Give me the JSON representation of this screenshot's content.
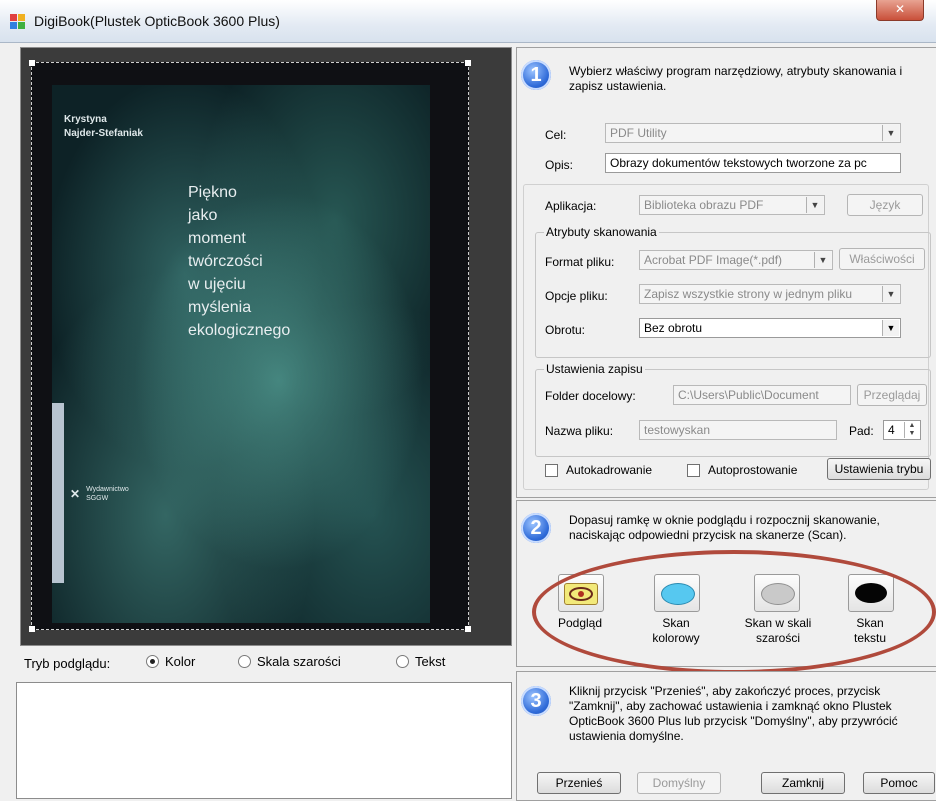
{
  "window": {
    "title": "DigiBook(Plustek OpticBook 3600 Plus)",
    "close_label": "✕"
  },
  "preview": {
    "book": {
      "author": "Krystyna\nNajder-Stefaniak",
      "title": "Piękno\njako\nmoment\ntwórczości\nw ujęciu\nmyślenia\nekologicznego",
      "publisher": "Wydawnictwo\nSGGW"
    },
    "mode_label": "Tryb podglądu:",
    "modes": [
      {
        "label": "Kolor",
        "selected": true
      },
      {
        "label": "Skala szarości",
        "selected": false
      },
      {
        "label": "Tekst",
        "selected": false
      }
    ]
  },
  "step1": {
    "number": "1",
    "text": "Wybierz właściwy program narzędziowy, atrybuty skanowania i zapisz ustawienia.",
    "target_label": "Cel:",
    "target_value": "PDF Utility",
    "desc_label": "Opis:",
    "desc_value": "Obrazy dokumentów tekstowych tworzone za pc",
    "app_label": "Aplikacja:",
    "app_value": "Biblioteka obrazu PDF",
    "lang_button": "Język",
    "attrs_group": "Atrybuty skanowania",
    "format_label": "Format pliku:",
    "format_value": "Acrobat PDF Image(*.pdf)",
    "props_button": "Właściwości",
    "options_label": "Opcje pliku:",
    "options_value": "Zapisz wszystkie strony w jednym pliku",
    "rotate_label": "Obrotu:",
    "rotate_value": "Bez obrotu",
    "save_group": "Ustawienia zapisu",
    "folder_label": "Folder docelowy:",
    "folder_value": "C:\\Users\\Public\\Document",
    "browse_button": "Przeglądaj",
    "filename_label": "Nazwa pliku:",
    "filename_value": "testowyskan",
    "pad_label": "Pad:",
    "pad_value": "4",
    "autocrop_label": "Autokadrowanie",
    "autostraighten_label": "Autoprostowanie",
    "mode_settings_button": "Ustawienia trybu"
  },
  "step2": {
    "number": "2",
    "text": "Dopasuj ramkę w oknie podglądu i rozpocznij skanowanie, naciskając odpowiedni przycisk na skanerze (Scan).",
    "buttons": [
      {
        "label": "Podgląd",
        "color": "#f2e97a"
      },
      {
        "label": "Skan\nkolorowy",
        "color": "#56c8f0"
      },
      {
        "label": "Skan w skali\nszarości",
        "color": "#c9c9c9"
      },
      {
        "label": "Skan\ntekstu",
        "color": "#050505"
      }
    ]
  },
  "step3": {
    "number": "3",
    "text": "Kliknij przycisk \"Przenieś\", aby zakończyć proces, przycisk \"Zamknij\", aby zachować ustawienia i zamknąć okno Plustek OpticBook 3600 Plus lub przycisk \"Domyślny\", aby przywrócić ustawienia domyślne.",
    "transfer_button": "Przenieś",
    "default_button": "Domyślny",
    "close_button": "Zamknij",
    "help_button": "Pomoc"
  },
  "colors": {
    "annotation_oval": "#b04a3c",
    "step_badge": "#2e6ad8"
  }
}
